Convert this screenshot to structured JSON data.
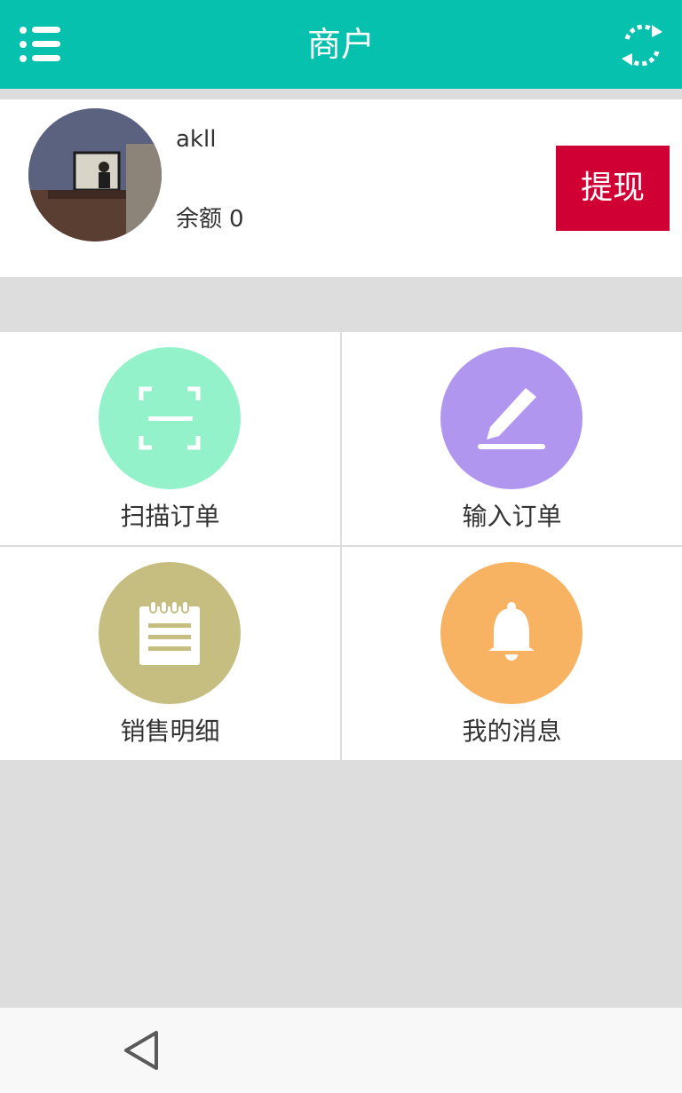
{
  "header": {
    "title": "商户",
    "menu_icon": "list-menu-icon",
    "refresh_icon": "refresh-icon",
    "bar_color": "#06c1ae"
  },
  "profile": {
    "username": "akll",
    "balance_label": "余额",
    "balance_value": "0",
    "withdraw_label": "提现",
    "withdraw_color": "#d10034"
  },
  "menu": {
    "items": [
      {
        "label": "扫描订单",
        "icon": "scan-icon",
        "color": "#93f2c9"
      },
      {
        "label": "输入订单",
        "icon": "pencil-icon",
        "color": "#b096ef"
      },
      {
        "label": "销售明细",
        "icon": "notepad-icon",
        "color": "#c6be80"
      },
      {
        "label": "我的消息",
        "icon": "bell-icon",
        "color": "#f7b262"
      }
    ]
  },
  "navbar": {
    "back_icon": "back-triangle-icon"
  }
}
